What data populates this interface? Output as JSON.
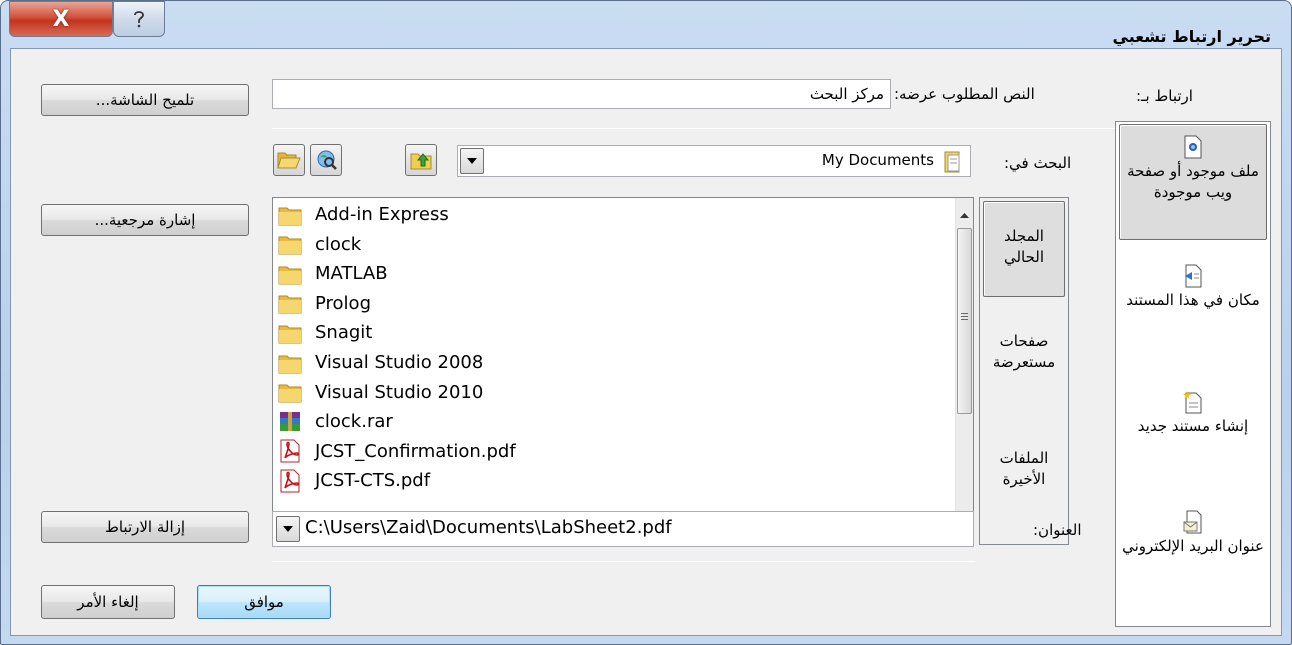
{
  "window": {
    "title": "تحرير ارتباط تشعبي",
    "close_glyph": "X",
    "help_glyph": "?"
  },
  "link_to_label": "ارتباط بـ:",
  "display_text": {
    "label": "النص المطلوب عرضه:",
    "value": "مركز البحث"
  },
  "screentip_button": "تلميح الشاشة...",
  "look_in": {
    "label": "البحث في:",
    "value": "My Documents"
  },
  "bookmark_button": "إشارة مرجعية...",
  "link_types": [
    {
      "label": "ملف موجود أو صفحة ويب موجودة",
      "icon": "existing-file-icon",
      "selected": true
    },
    {
      "label": "مكان في هذا المستند",
      "icon": "place-in-document-icon",
      "selected": false
    },
    {
      "label": "إنشاء مستند جديد",
      "icon": "new-document-icon",
      "selected": false
    },
    {
      "label": "عنوان البريد الإلكتروني",
      "icon": "email-address-icon",
      "selected": false
    }
  ],
  "places": [
    {
      "label": "المجلد الحالي",
      "selected": true
    },
    {
      "label": "صفحات مستعرضة",
      "selected": false
    },
    {
      "label": "الملفات الأخيرة",
      "selected": false
    }
  ],
  "files": [
    {
      "name": "Add-in Express",
      "type": "folder"
    },
    {
      "name": "clock",
      "type": "folder"
    },
    {
      "name": "MATLAB",
      "type": "folder"
    },
    {
      "name": "Prolog",
      "type": "folder"
    },
    {
      "name": "Snagit",
      "type": "folder"
    },
    {
      "name": "Visual Studio 2008",
      "type": "folder"
    },
    {
      "name": "Visual Studio 2010",
      "type": "folder"
    },
    {
      "name": "clock.rar",
      "type": "rar"
    },
    {
      "name": "JCST_Confirmation.pdf",
      "type": "pdf"
    },
    {
      "name": "JCST-CTS.pdf",
      "type": "pdf"
    }
  ],
  "address": {
    "label": "العنوان:",
    "value": "C:\\Users\\Zaid\\Documents\\LabSheet2.pdf"
  },
  "remove_link_button": "إزالة الارتباط",
  "ok_button": "موافق",
  "cancel_button": "إلغاء الأمر"
}
